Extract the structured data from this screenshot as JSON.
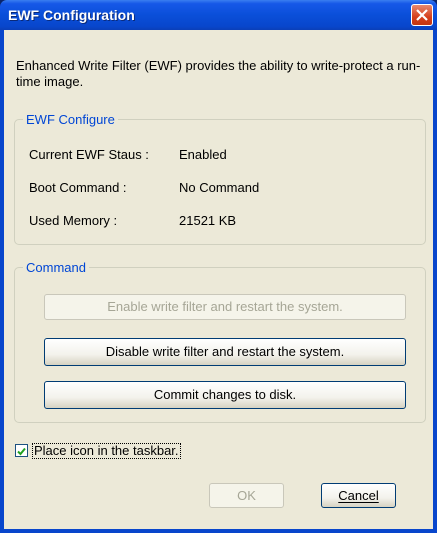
{
  "window": {
    "title": "EWF Configuration"
  },
  "description": "Enhanced Write Filter (EWF) provides the ability to write-protect a run-time image.",
  "configure_group": {
    "title": "EWF Configure",
    "rows": [
      {
        "label": "Current EWF Staus :",
        "value": "Enabled"
      },
      {
        "label": "Boot Command :",
        "value": "No Command"
      },
      {
        "label": "Used Memory :",
        "value": "21521 KB"
      }
    ]
  },
  "command_group": {
    "title": "Command",
    "enable_button": "Enable write filter and restart the system.",
    "disable_button": "Disable write filter and restart the system.",
    "commit_button": "Commit changes to disk."
  },
  "taskbar_checkbox": {
    "label": "Place icon in the taskbar.",
    "checked": true
  },
  "footer": {
    "ok_label": "OK",
    "cancel_label": "Cancel"
  },
  "colors": {
    "title_bar": "#0846cc",
    "group_title": "#0046d5",
    "dialog_bg": "#ece9d8",
    "close_button": "#d6401c"
  }
}
